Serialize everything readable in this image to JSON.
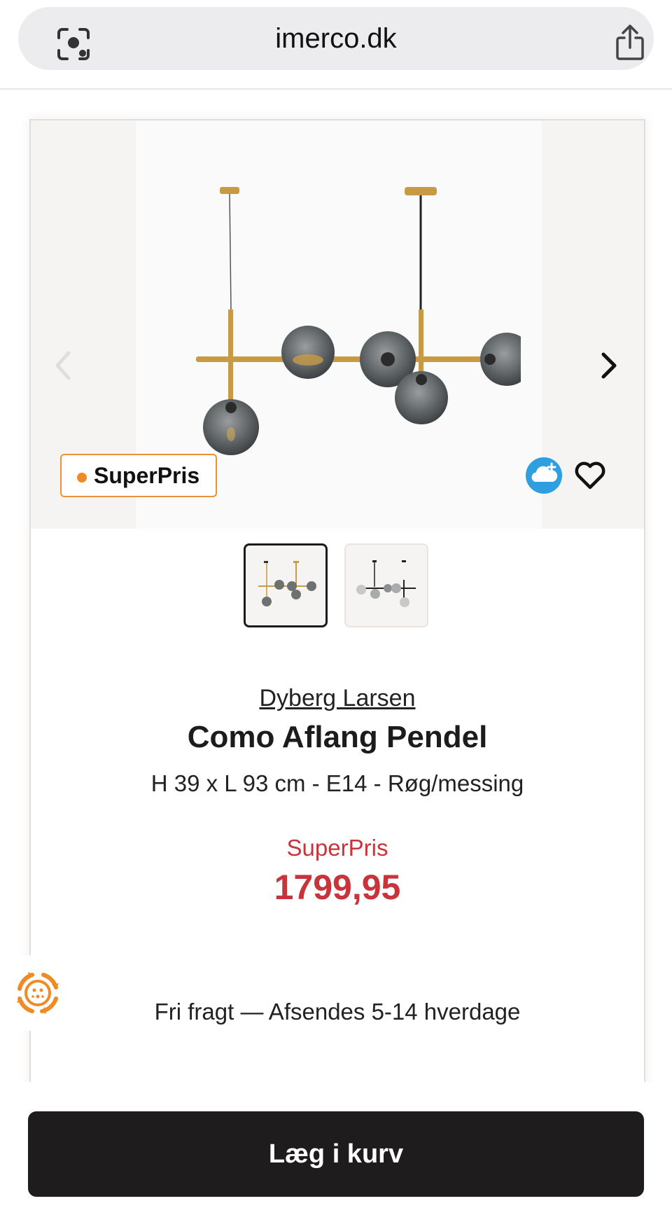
{
  "browser": {
    "url": "imerco.dk"
  },
  "product": {
    "badge_label": "SuperPris",
    "brand": "Dyberg Larsen",
    "title": "Como Aflang Pendel",
    "subtitle": "H 39 x L 93 cm - E14 - Røg/messing",
    "price_label": "SuperPris",
    "price": "1799,95",
    "shipping": "Fri fragt — Afsendes 5-14 hverdage",
    "gallery": {
      "thumbnails": [
        "brass-variant",
        "black-variant"
      ],
      "selected_index": 0
    }
  },
  "actions": {
    "add_to_cart_label": "Læg i kurv"
  },
  "colors": {
    "accent_orange": "#ef8a24",
    "price_red": "#c9343b",
    "button_dark": "#1f1c1d",
    "brass": "#c79a45",
    "cloud_blue": "#2f9fe0"
  },
  "icons": {
    "address_bar_left": "camera-lens-icon",
    "address_bar_right": "share-icon",
    "gallery_prev": "chevron-left-icon",
    "gallery_next": "chevron-right-icon",
    "cloud": "cloud-plus-icon",
    "favorite": "heart-icon",
    "side_widget": "recycle-cycle-icon"
  }
}
